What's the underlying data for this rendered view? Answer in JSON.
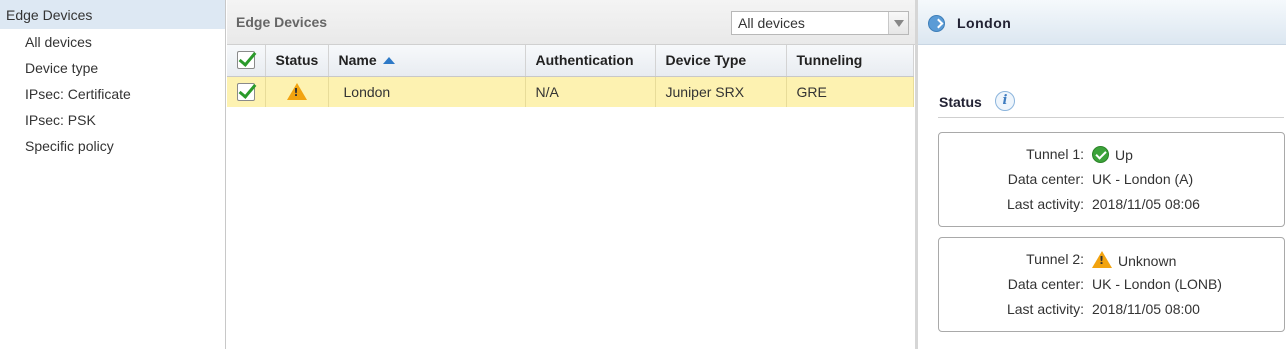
{
  "nav": {
    "header": "Edge Devices",
    "items": [
      "All devices",
      "Device type",
      "IPsec: Certificate",
      "IPsec: PSK",
      "Specific policy"
    ]
  },
  "list": {
    "title": "Edge Devices",
    "filter_selected": "All devices",
    "columns": {
      "status": "Status",
      "name": "Name",
      "authentication": "Authentication",
      "device_type": "Device Type",
      "tunneling": "Tunneling"
    },
    "rows": [
      {
        "name": "London",
        "authentication": "N/A",
        "device_type": "Juniper SRX",
        "tunneling": "GRE",
        "status_icon": "warning-icon",
        "checked": true
      }
    ]
  },
  "detail": {
    "title": "London",
    "status_title": "Status",
    "info_glyph": "i",
    "tunnels": [
      {
        "tunnel_label": "Tunnel 1:",
        "tunnel_value": "Up",
        "icon": "ok-icon",
        "dc_label": "Data center:",
        "dc_value": "UK - London (A)",
        "activity_label": "Last activity:",
        "activity_value": "2018/11/05 08:06"
      },
      {
        "tunnel_label": "Tunnel 2:",
        "tunnel_value": "Unknown",
        "icon": "warning-icon",
        "dc_label": "Data center:",
        "dc_value": "UK - London (LONB)",
        "activity_label": "Last activity:",
        "activity_value": "2018/11/05 08:00"
      }
    ]
  },
  "colors": {
    "nav_selected": "#dde8f3",
    "row_selected": "#fdf2b1",
    "sort_arrow": "#2d79c7",
    "ok": "#3ca33a",
    "warning": "#f2a30f"
  }
}
